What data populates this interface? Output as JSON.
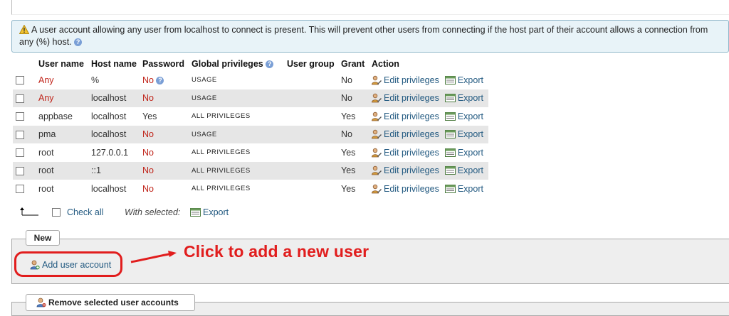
{
  "notice": {
    "text": "A user account allowing any user from localhost to connect is present. This will prevent other users from connecting if the host part of their account allows a connection from any (%) host.",
    "help_glyph": "?"
  },
  "table": {
    "headers": {
      "user_name": "User name",
      "host_name": "Host name",
      "password": "Password",
      "global_privileges": "Global privileges",
      "user_group": "User group",
      "grant": "Grant",
      "action": "Action"
    },
    "rows": [
      {
        "user": "Any",
        "host": "%",
        "password": "No",
        "privileges": "USAGE",
        "grant": "No"
      },
      {
        "user": "Any",
        "host": "localhost",
        "password": "No",
        "privileges": "USAGE",
        "grant": "No"
      },
      {
        "user": "appbase",
        "host": "localhost",
        "password": "Yes",
        "privileges": "ALL PRIVILEGES",
        "grant": "Yes"
      },
      {
        "user": "pma",
        "host": "localhost",
        "password": "No",
        "privileges": "USAGE",
        "grant": "No"
      },
      {
        "user": "root",
        "host": "127.0.0.1",
        "password": "No",
        "privileges": "ALL PRIVILEGES",
        "grant": "Yes"
      },
      {
        "user": "root",
        "host": "::1",
        "password": "No",
        "privileges": "ALL PRIVILEGES",
        "grant": "Yes"
      },
      {
        "user": "root",
        "host": "localhost",
        "password": "No",
        "privileges": "ALL PRIVILEGES",
        "grant": "Yes"
      }
    ],
    "edit_label": "Edit privileges",
    "export_label": "Export"
  },
  "bulk": {
    "check_all": "Check all",
    "with_selected": "With selected:",
    "export": "Export"
  },
  "new_section": {
    "legend": "New",
    "add_user": "Add user account"
  },
  "annotation": {
    "text": "Click to add a new user",
    "color": "#e11d1d"
  },
  "remove_section": {
    "legend": "Remove selected user accounts"
  },
  "colors": {
    "link": "#235a81",
    "warning_red": "#c0241a",
    "notice_bg": "#e8f3f8",
    "alt_row": "#e6e6e6"
  }
}
